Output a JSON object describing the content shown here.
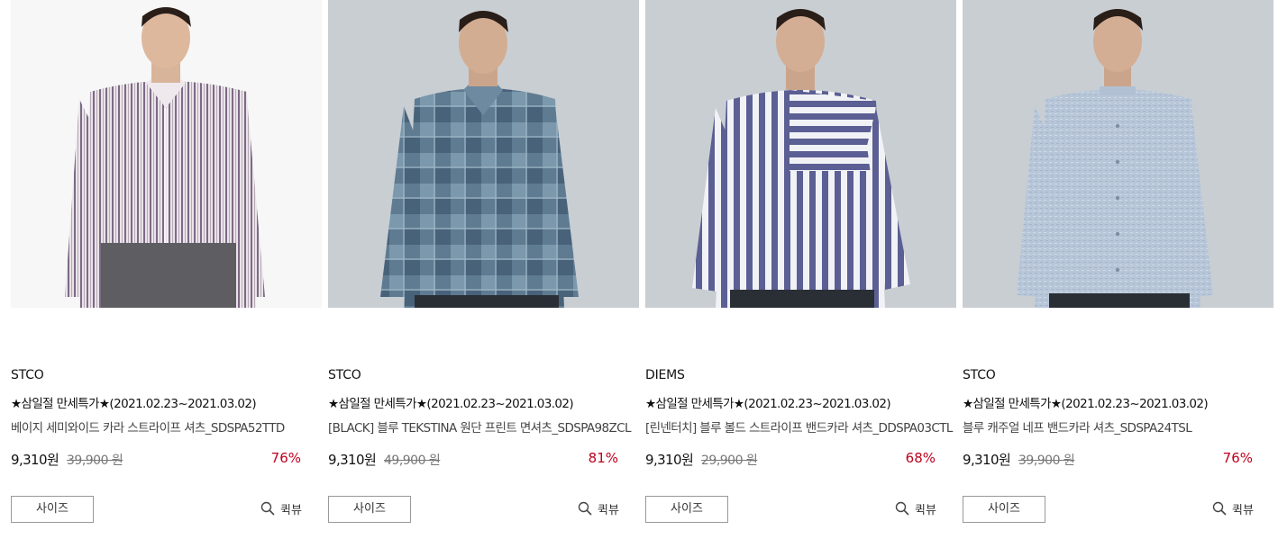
{
  "products": [
    {
      "brand": "STCO",
      "promo": "★삼일절 만세특가★(2021.02.23~2021.03.02)",
      "name": "베이지 세미와이드 카라 스트라이프 셔츠_SDSPA52TTD",
      "sale_price": "9,310원",
      "original_price": "39,900 원",
      "discount": "76%",
      "size_label": "사이즈",
      "quickview_label": "퀵뷰",
      "image_desc": "model in beige/purple striped semi-wide collar shirt"
    },
    {
      "brand": "STCO",
      "promo": "★삼일절 만세특가★(2021.02.23~2021.03.02)",
      "name": "[BLACK] 블루 TEKSTINA 원단 프린트 면셔츠_SDSPA98ZCL",
      "sale_price": "9,310원",
      "original_price": "49,900 원",
      "discount": "81%",
      "size_label": "사이즈",
      "quickview_label": "퀵뷰",
      "image_desc": "model in blue check print cotton shirt"
    },
    {
      "brand": "DIEMS",
      "promo": "★삼일절 만세특가★(2021.02.23~2021.03.02)",
      "name": "[린넨터치] 블루 볼드 스트라이프 밴드카라 셔츠_DDSPA03CTL",
      "sale_price": "9,310원",
      "original_price": "29,900 원",
      "discount": "68%",
      "size_label": "사이즈",
      "quickview_label": "퀵뷰",
      "image_desc": "model in blue bold stripe band collar shirt"
    },
    {
      "brand": "STCO",
      "promo": "★삼일절 만세특가★(2021.02.23~2021.03.02)",
      "name": "블루 캐주얼 네프 밴드카라 셔츠_SDSPA24TSL",
      "sale_price": "9,310원",
      "original_price": "39,900 원",
      "discount": "76%",
      "size_label": "사이즈",
      "quickview_label": "퀵뷰",
      "image_desc": "model in light blue casual band collar shirt"
    }
  ],
  "colors": {
    "discount": "#c0001d",
    "border": "#999999",
    "photo_bg_1": "#f4f4f4",
    "photo_bg_other": "#c9ced3"
  },
  "icons": {
    "quickview": "search-icon"
  }
}
